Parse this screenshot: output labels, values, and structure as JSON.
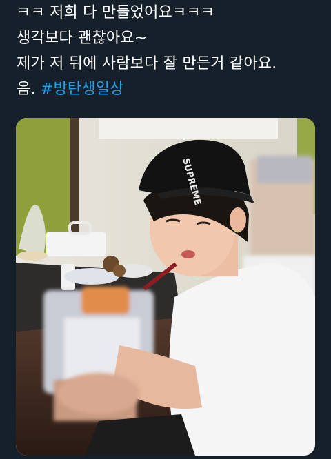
{
  "tweet": {
    "text_lines": [
      "ㅋㅋ 저희 다 만들었어요ㅋㅋㅋ",
      "생각보다 괜찮아요~",
      "제가 저 뒤에 사람보다 잘 만든거 같아요."
    ],
    "last_line_prefix": "음. ",
    "hashtag": "#방탄생일상"
  },
  "media": {
    "alt_icon": "photo-icon",
    "cap_text": "SUPREME"
  },
  "colors": {
    "background": "#15202b",
    "text": "#ffffff",
    "hashtag": "#1da1f2"
  }
}
